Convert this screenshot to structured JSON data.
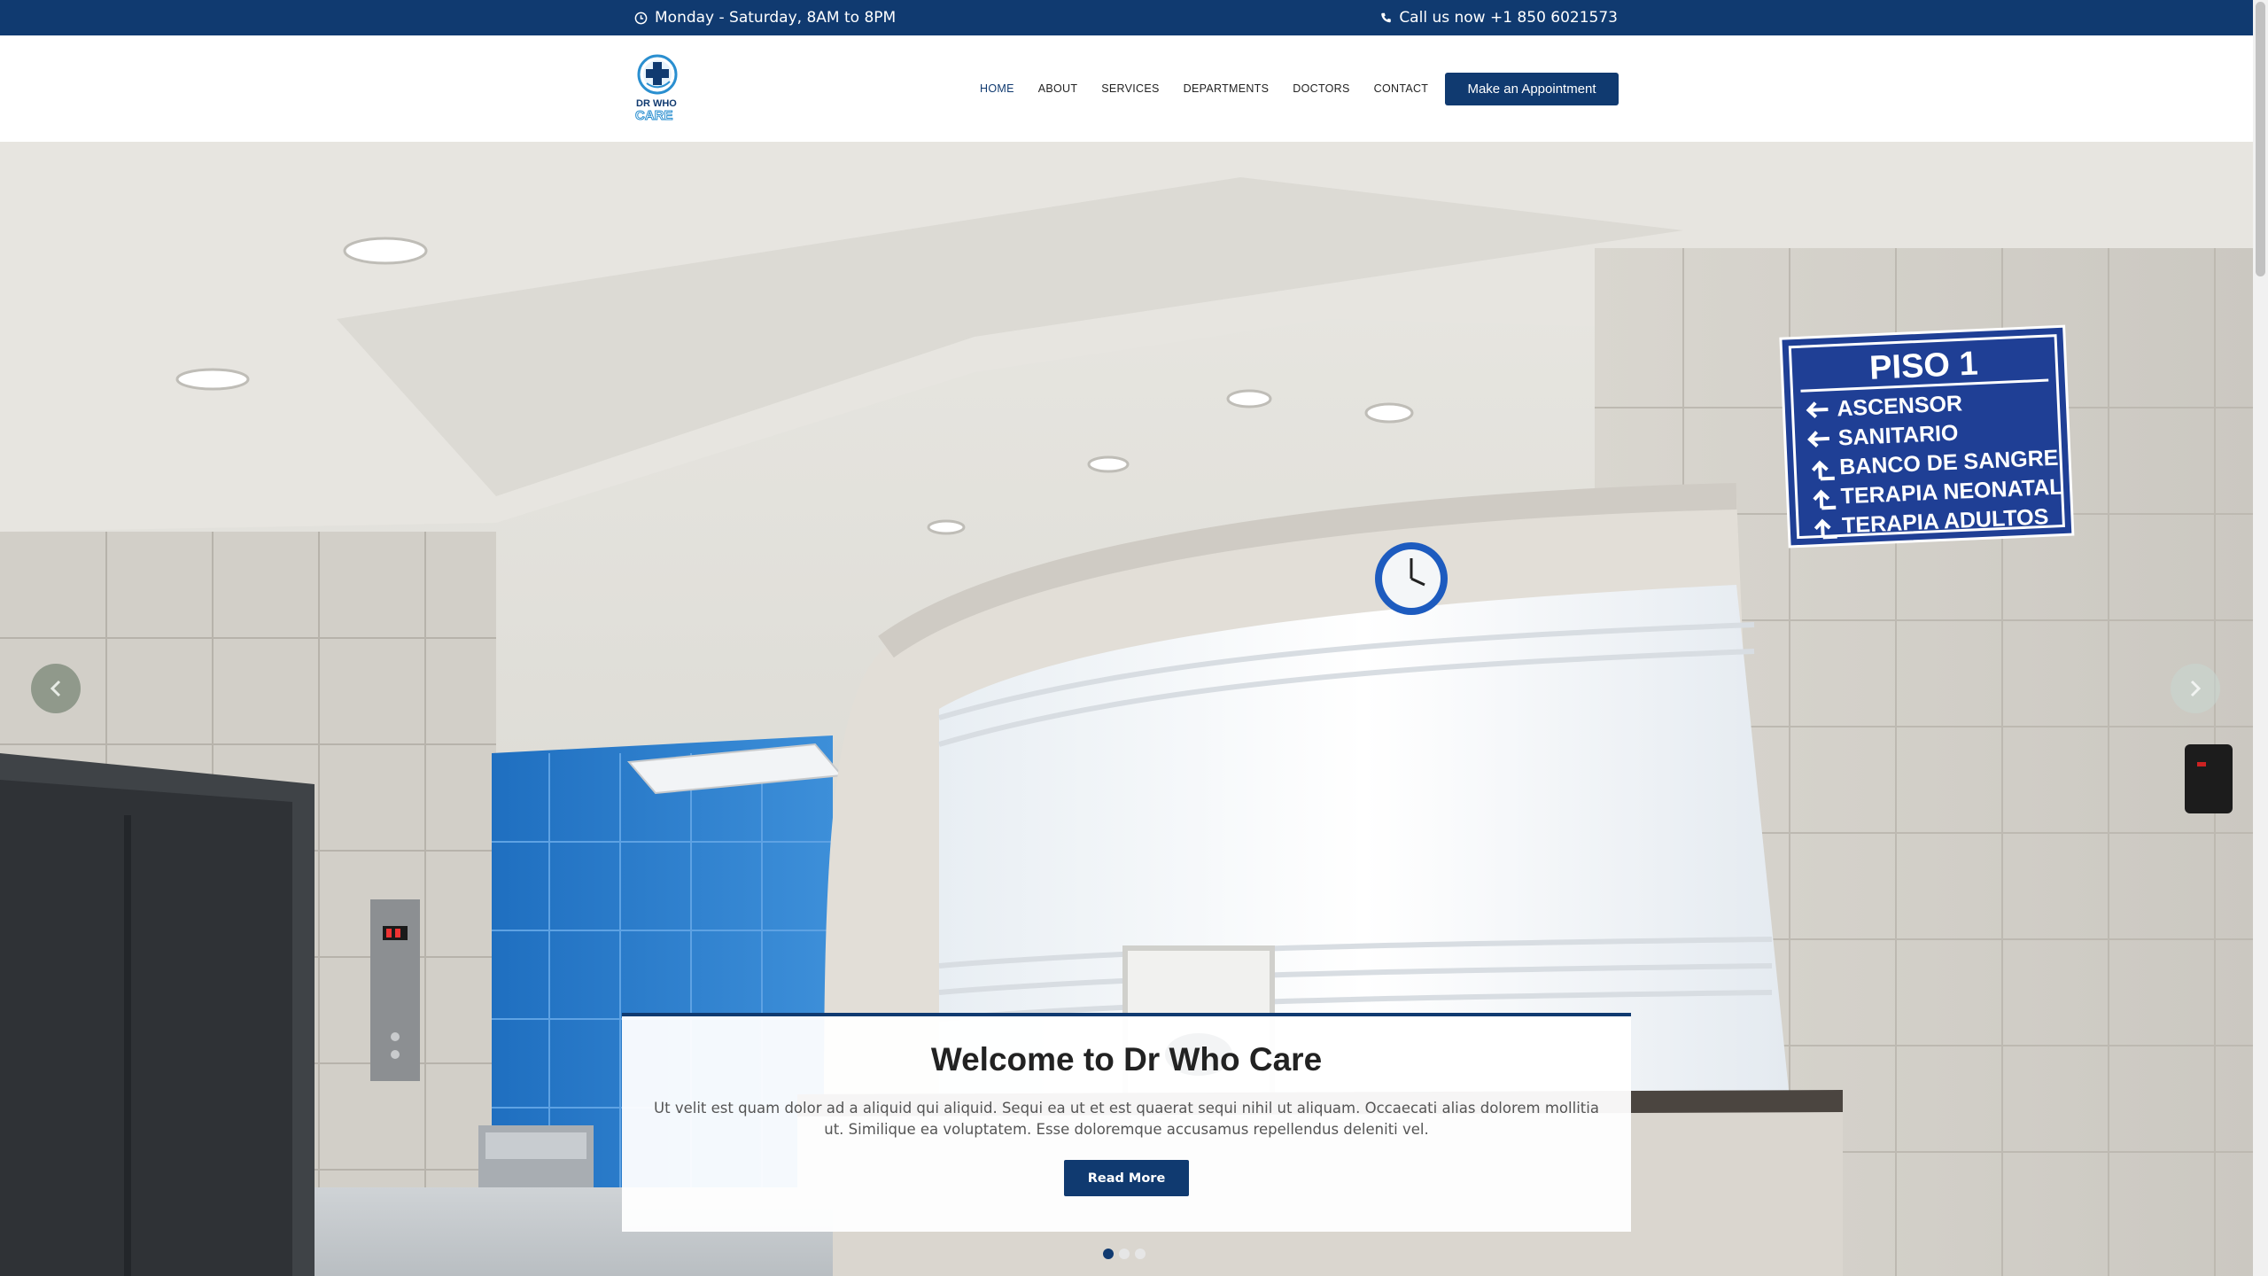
{
  "topbar": {
    "hours": "Monday - Saturday, 8AM to 8PM",
    "phone": "Call us now +1 850 6021573"
  },
  "brand": {
    "logo_line1": "DR WHO",
    "logo_line2": "CARE"
  },
  "nav": {
    "items": [
      "HOME",
      "ABOUT",
      "SERVICES",
      "DEPARTMENTS",
      "DOCTORS",
      "CONTACT"
    ],
    "active": "HOME",
    "cta": "Make an Appointment"
  },
  "hero": {
    "sign": {
      "title": "PISO 1",
      "lines": [
        "ASCENSOR",
        "SANITARIO",
        "BANCO DE SANGRE",
        "TERAPIA NEONATAL",
        "TERAPIA ADULTOS"
      ]
    },
    "title": "Welcome to Dr Who Care",
    "body": "Ut velit est quam dolor ad a aliquid qui aliquid. Sequi ea ut et est quaerat sequi nihil ut aliquam. Occaecati alias dolorem mollitia ut. Similique ea voluptatem. Esse doloremque accusamus repellendus deleniti vel.",
    "button": "Read More",
    "slides": 3,
    "active_slide": 1
  },
  "colors": {
    "primary": "#103a70",
    "white": "#ffffff"
  },
  "icons": {
    "hours": "clock-icon",
    "phone": "phone-icon",
    "prev": "chevron-left-icon",
    "next": "chevron-right-icon"
  }
}
